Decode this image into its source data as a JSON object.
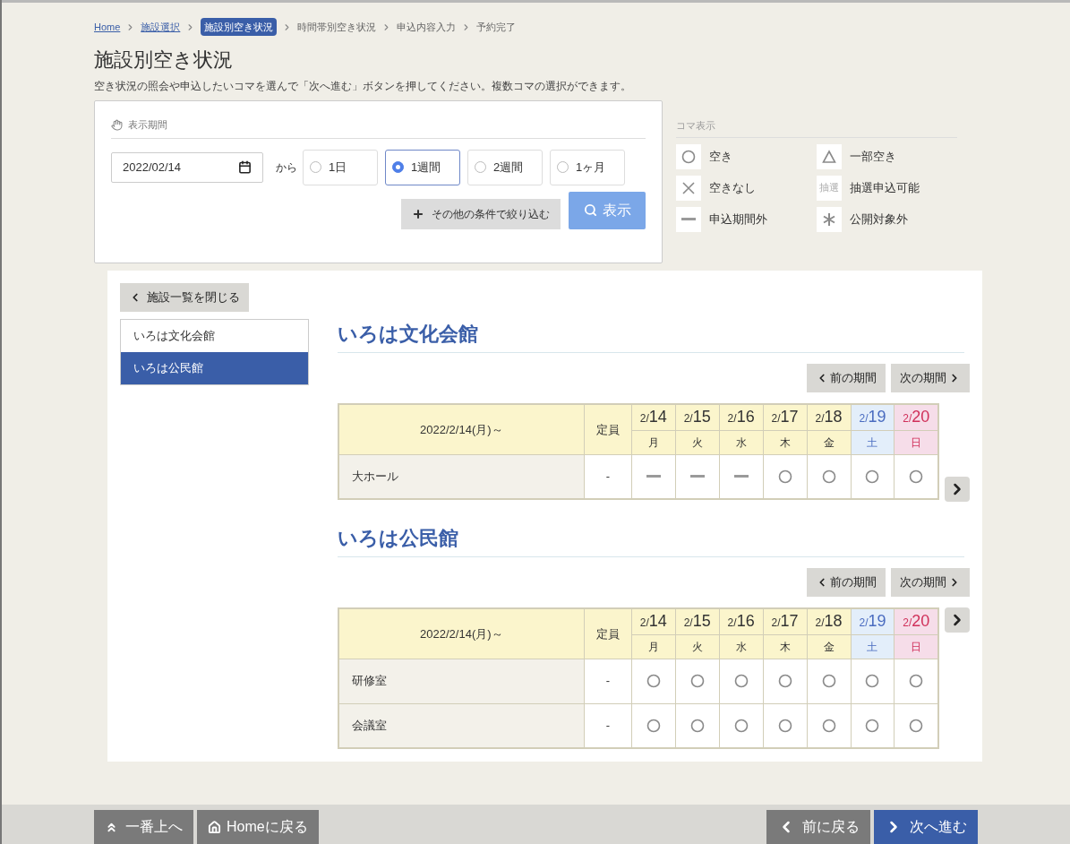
{
  "breadcrumb": [
    {
      "label": "Home",
      "kind": "link"
    },
    {
      "label": "施設選択",
      "kind": "link"
    },
    {
      "label": "施設別空き状況",
      "kind": "current"
    },
    {
      "label": "時間帯別空き状況",
      "kind": "plain"
    },
    {
      "label": "申込内容入力",
      "kind": "plain"
    },
    {
      "label": "予約完了",
      "kind": "plain"
    }
  ],
  "title": "施設別空き状況",
  "description": "空き状況の照会や申込したいコマを選んで「次へ進む」ボタンを押してください。複数コマの選択ができます。",
  "period": {
    "heading": "表示期間",
    "date": "2022/02/14",
    "from_label": "から",
    "options": [
      {
        "label": "1日",
        "selected": false
      },
      {
        "label": "1週間",
        "selected": true
      },
      {
        "label": "2週間",
        "selected": false
      },
      {
        "label": "1ヶ月",
        "selected": false
      }
    ],
    "filter_button": "その他の条件で絞り込む",
    "show_button": "表示"
  },
  "legend": {
    "heading": "コマ表示",
    "items": [
      {
        "kind": "circle",
        "label": "空き"
      },
      {
        "kind": "triangle",
        "label": "一部空き"
      },
      {
        "kind": "cross",
        "label": "空きなし"
      },
      {
        "kind": "lottery",
        "icon_text": "抽選",
        "label": "抽選申込可能"
      },
      {
        "kind": "dash",
        "label": "申込期間外"
      },
      {
        "kind": "asterisk",
        "label": "公開対象外"
      }
    ]
  },
  "close_list_button": "施設一覧を閉じる",
  "facility_list": [
    {
      "label": "いろは文化会館",
      "selected": false
    },
    {
      "label": "いろは公民館",
      "selected": true
    }
  ],
  "facilities": [
    {
      "name": "いろは文化会館",
      "prev_button": "前の期間",
      "next_button": "次の期間",
      "range": "2022/2/14(月)～",
      "capacity_header": "定員",
      "days": [
        {
          "month": "2/",
          "day": "14",
          "weekday": "月",
          "kind": "weekday"
        },
        {
          "month": "2/",
          "day": "15",
          "weekday": "火",
          "kind": "weekday"
        },
        {
          "month": "2/",
          "day": "16",
          "weekday": "水",
          "kind": "weekday"
        },
        {
          "month": "2/",
          "day": "17",
          "weekday": "木",
          "kind": "weekday"
        },
        {
          "month": "2/",
          "day": "18",
          "weekday": "金",
          "kind": "weekday"
        },
        {
          "month": "2/",
          "day": "19",
          "weekday": "土",
          "kind": "saturday"
        },
        {
          "month": "2/",
          "day": "20",
          "weekday": "日",
          "kind": "sunday"
        }
      ],
      "rooms": [
        {
          "name": "大ホール",
          "capacity": "-",
          "slots": [
            {
              "kind": "dash"
            },
            {
              "kind": "dash"
            },
            {
              "kind": "dash"
            },
            {
              "kind": "circle"
            },
            {
              "kind": "circle"
            },
            {
              "kind": "circle"
            },
            {
              "kind": "circle"
            }
          ]
        }
      ]
    },
    {
      "name": "いろは公民館",
      "prev_button": "前の期間",
      "next_button": "次の期間",
      "range": "2022/2/14(月)～",
      "capacity_header": "定員",
      "days": [
        {
          "month": "2/",
          "day": "14",
          "weekday": "月",
          "kind": "weekday"
        },
        {
          "month": "2/",
          "day": "15",
          "weekday": "火",
          "kind": "weekday"
        },
        {
          "month": "2/",
          "day": "16",
          "weekday": "水",
          "kind": "weekday"
        },
        {
          "month": "2/",
          "day": "17",
          "weekday": "木",
          "kind": "weekday"
        },
        {
          "month": "2/",
          "day": "18",
          "weekday": "金",
          "kind": "weekday"
        },
        {
          "month": "2/",
          "day": "19",
          "weekday": "土",
          "kind": "saturday"
        },
        {
          "month": "2/",
          "day": "20",
          "weekday": "日",
          "kind": "sunday"
        }
      ],
      "rooms": [
        {
          "name": "研修室",
          "capacity": "-",
          "slots": [
            {
              "kind": "circle"
            },
            {
              "kind": "circle"
            },
            {
              "kind": "circle"
            },
            {
              "kind": "circle"
            },
            {
              "kind": "circle"
            },
            {
              "kind": "circle"
            },
            {
              "kind": "circle"
            }
          ]
        },
        {
          "name": "会議室",
          "capacity": "-",
          "slots": [
            {
              "kind": "circle"
            },
            {
              "kind": "circle"
            },
            {
              "kind": "circle"
            },
            {
              "kind": "circle"
            },
            {
              "kind": "circle"
            },
            {
              "kind": "circle"
            },
            {
              "kind": "circle"
            }
          ]
        }
      ]
    }
  ],
  "footer": {
    "top_button": "一番上へ",
    "home_button": "Homeに戻る",
    "back_button": "前に戻る",
    "next_button": "次へ進む"
  }
}
